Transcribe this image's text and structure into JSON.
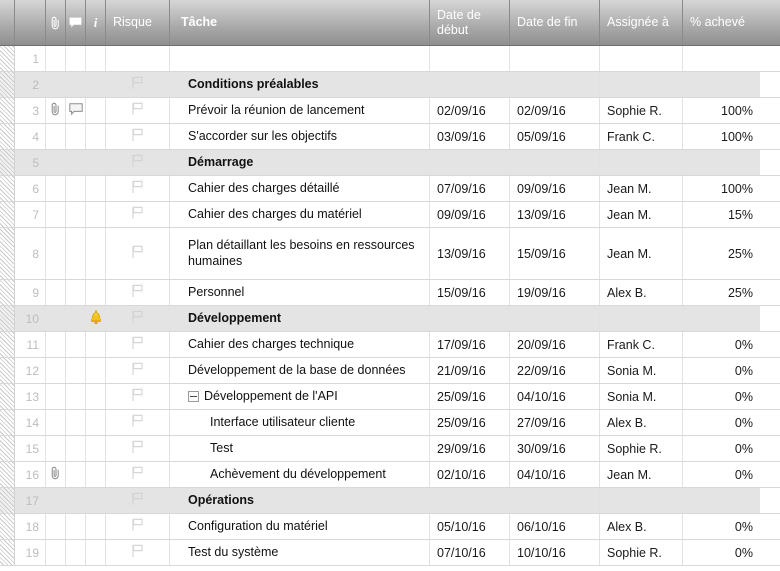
{
  "columns": [
    {
      "key": "gutter",
      "label": "",
      "icon": "",
      "cls": "c-gut"
    },
    {
      "key": "rownum",
      "label": "",
      "icon": "",
      "cls": "c-num"
    },
    {
      "key": "attachment",
      "label": "",
      "icon": "paperclip-icon",
      "cls": "c-clip"
    },
    {
      "key": "comment",
      "label": "",
      "icon": "comment-icon",
      "cls": "c-note"
    },
    {
      "key": "info",
      "label": "",
      "icon": "info-icon",
      "cls": "c-info"
    },
    {
      "key": "risk",
      "label": "Risque",
      "icon": "",
      "cls": "c-risk"
    },
    {
      "key": "task",
      "label": "Tâche",
      "icon": "",
      "cls": "c-task"
    },
    {
      "key": "start",
      "label": "Date de début",
      "icon": "",
      "cls": "c-start"
    },
    {
      "key": "end",
      "label": "Date de fin",
      "icon": "",
      "cls": "c-end"
    },
    {
      "key": "assignee",
      "label": "Assignée à",
      "icon": "",
      "cls": "c-assig"
    },
    {
      "key": "percent",
      "label": "% achevé",
      "icon": "",
      "cls": "c-pct"
    }
  ],
  "header": {
    "attachment_label": "",
    "comment_label": "",
    "info_label": "i",
    "risk_label": "Risque",
    "task_label": "Tâche",
    "start_label": "Date de début",
    "end_label": "Date de fin",
    "assignee_label": "Assignée à",
    "percent_label": "% achevé"
  },
  "colors": {
    "header_gradient_top": "#d6d6d6",
    "header_gradient_bottom": "#8f8f8f",
    "header_text": "#ffffff",
    "parent_row_bg": "#e4e4e4",
    "row_bg": "#ffffff",
    "grid_line": "#d8d8d8",
    "row_number_text": "#bdbdbd",
    "bell_icon": "#f2c31c",
    "task_text": "#111111"
  },
  "rows": [
    {
      "num": "1",
      "parent": false,
      "empty": true,
      "attachment": false,
      "comment": false,
      "bell": false,
      "flag": false,
      "task": "",
      "indent": 1,
      "toggle": false,
      "start": "",
      "end": "",
      "assignee": "",
      "percent": ""
    },
    {
      "num": "2",
      "parent": true,
      "empty": false,
      "attachment": false,
      "comment": false,
      "bell": false,
      "flag": true,
      "task": "Conditions préalables",
      "indent": 1,
      "toggle": false,
      "start": "",
      "end": "",
      "assignee": "",
      "percent": ""
    },
    {
      "num": "3",
      "parent": false,
      "empty": false,
      "attachment": true,
      "comment": true,
      "bell": false,
      "flag": true,
      "task": "Prévoir la réunion de lancement",
      "indent": 1,
      "toggle": false,
      "start": "02/09/16",
      "end": "02/09/16",
      "assignee": "Sophie R.",
      "percent": "100%"
    },
    {
      "num": "4",
      "parent": false,
      "empty": false,
      "attachment": false,
      "comment": false,
      "bell": false,
      "flag": true,
      "task": "S'accorder sur les objectifs",
      "indent": 1,
      "toggle": false,
      "start": "03/09/16",
      "end": "05/09/16",
      "assignee": "Frank C.",
      "percent": "100%"
    },
    {
      "num": "5",
      "parent": true,
      "empty": false,
      "attachment": false,
      "comment": false,
      "bell": false,
      "flag": true,
      "task": "Démarrage",
      "indent": 1,
      "toggle": false,
      "start": "",
      "end": "",
      "assignee": "",
      "percent": ""
    },
    {
      "num": "6",
      "parent": false,
      "empty": false,
      "attachment": false,
      "comment": false,
      "bell": false,
      "flag": true,
      "task": "Cahier des charges détaillé",
      "indent": 1,
      "toggle": false,
      "start": "07/09/16",
      "end": "09/09/16",
      "assignee": "Jean M.",
      "percent": "100%"
    },
    {
      "num": "7",
      "parent": false,
      "empty": false,
      "attachment": false,
      "comment": false,
      "bell": false,
      "flag": true,
      "task": "Cahier des charges du matériel",
      "indent": 1,
      "toggle": false,
      "start": "09/09/16",
      "end": "13/09/16",
      "assignee": "Jean M.",
      "percent": "15%"
    },
    {
      "num": "8",
      "parent": false,
      "empty": false,
      "attachment": false,
      "comment": false,
      "bell": false,
      "flag": true,
      "task": "Plan détaillant les besoins en ressources humaines",
      "indent": 1,
      "toggle": false,
      "start": "13/09/16",
      "end": "15/09/16",
      "assignee": "Jean M.",
      "percent": "25%",
      "tall": true
    },
    {
      "num": "9",
      "parent": false,
      "empty": false,
      "attachment": false,
      "comment": false,
      "bell": false,
      "flag": true,
      "task": "Personnel",
      "indent": 1,
      "toggle": false,
      "start": "15/09/16",
      "end": "19/09/16",
      "assignee": "Alex B.",
      "percent": "25%"
    },
    {
      "num": "10",
      "parent": true,
      "empty": false,
      "attachment": false,
      "comment": false,
      "bell": true,
      "flag": true,
      "task": "Développement",
      "indent": 1,
      "toggle": false,
      "start": "",
      "end": "",
      "assignee": "",
      "percent": ""
    },
    {
      "num": "11",
      "parent": false,
      "empty": false,
      "attachment": false,
      "comment": false,
      "bell": false,
      "flag": true,
      "task": "Cahier des charges technique",
      "indent": 1,
      "toggle": false,
      "start": "17/09/16",
      "end": "20/09/16",
      "assignee": "Frank C.",
      "percent": "0%"
    },
    {
      "num": "12",
      "parent": false,
      "empty": false,
      "attachment": false,
      "comment": false,
      "bell": false,
      "flag": true,
      "task": "Développement de la base de données",
      "indent": 1,
      "toggle": false,
      "start": "21/09/16",
      "end": "22/09/16",
      "assignee": "Sonia M.",
      "percent": "0%"
    },
    {
      "num": "13",
      "parent": false,
      "empty": false,
      "attachment": false,
      "comment": false,
      "bell": false,
      "flag": true,
      "task": "Développement de l'API",
      "indent": 2,
      "toggle": true,
      "start": "25/09/16",
      "end": "04/10/16",
      "assignee": "Sonia M.",
      "percent": "0%"
    },
    {
      "num": "14",
      "parent": false,
      "empty": false,
      "attachment": false,
      "comment": false,
      "bell": false,
      "flag": true,
      "task": "Interface utilisateur cliente",
      "indent": 3,
      "toggle": false,
      "start": "25/09/16",
      "end": "27/09/16",
      "assignee": "Alex B.",
      "percent": "0%"
    },
    {
      "num": "15",
      "parent": false,
      "empty": false,
      "attachment": false,
      "comment": false,
      "bell": false,
      "flag": true,
      "task": "Test",
      "indent": 3,
      "toggle": false,
      "start": "29/09/16",
      "end": "30/09/16",
      "assignee": "Sophie R.",
      "percent": "0%"
    },
    {
      "num": "16",
      "parent": false,
      "empty": false,
      "attachment": true,
      "comment": false,
      "bell": false,
      "flag": true,
      "task": "Achèvement du développement",
      "indent": 3,
      "toggle": false,
      "start": "02/10/16",
      "end": "04/10/16",
      "assignee": "Jean M.",
      "percent": "0%"
    },
    {
      "num": "17",
      "parent": true,
      "empty": false,
      "attachment": false,
      "comment": false,
      "bell": false,
      "flag": true,
      "task": "Opérations",
      "indent": 1,
      "toggle": false,
      "start": "",
      "end": "",
      "assignee": "",
      "percent": ""
    },
    {
      "num": "18",
      "parent": false,
      "empty": false,
      "attachment": false,
      "comment": false,
      "bell": false,
      "flag": true,
      "task": "Configuration du matériel",
      "indent": 1,
      "toggle": false,
      "start": "05/10/16",
      "end": "06/10/16",
      "assignee": "Alex B.",
      "percent": "0%"
    },
    {
      "num": "19",
      "parent": false,
      "empty": false,
      "attachment": false,
      "comment": false,
      "bell": false,
      "flag": true,
      "task": "Test du système",
      "indent": 1,
      "toggle": false,
      "start": "07/10/16",
      "end": "10/10/16",
      "assignee": "Sophie R.",
      "percent": "0%"
    }
  ]
}
